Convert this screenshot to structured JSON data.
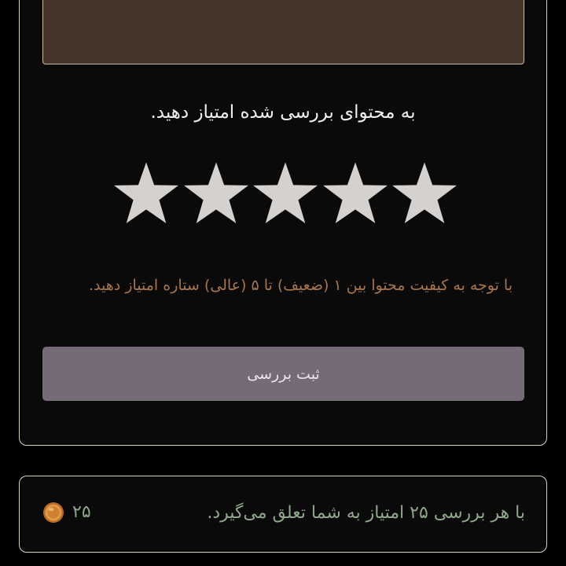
{
  "review": {
    "title": "به محتوای بررسی شده امتیاز دهید.",
    "rating": 0,
    "max_rating": 5,
    "stars": [
      {
        "label": "1"
      },
      {
        "label": "2"
      },
      {
        "label": "3"
      },
      {
        "label": "4"
      },
      {
        "label": "5"
      }
    ],
    "hint": "با توجه به کیفیت محتوا بین ۱ (ضعیف) تا ۵ (عالی) ستاره امتیاز دهید.",
    "submit_label": "ثبت بررسی"
  },
  "reward": {
    "text": "با هر بررسی ۲۵ امتیاز به شما تعلق می‌گیرد.",
    "points": "۲۵",
    "icon": "coin-icon"
  },
  "colors": {
    "background": "#000000",
    "card_border": "#d8cfbe",
    "textarea_bg": "#46352a",
    "star_color": "#d4d1ce",
    "hint_color": "#a8754a",
    "button_bg": "#746b77",
    "reward_text": "#8fa78a",
    "coin": "#d98c3a"
  }
}
